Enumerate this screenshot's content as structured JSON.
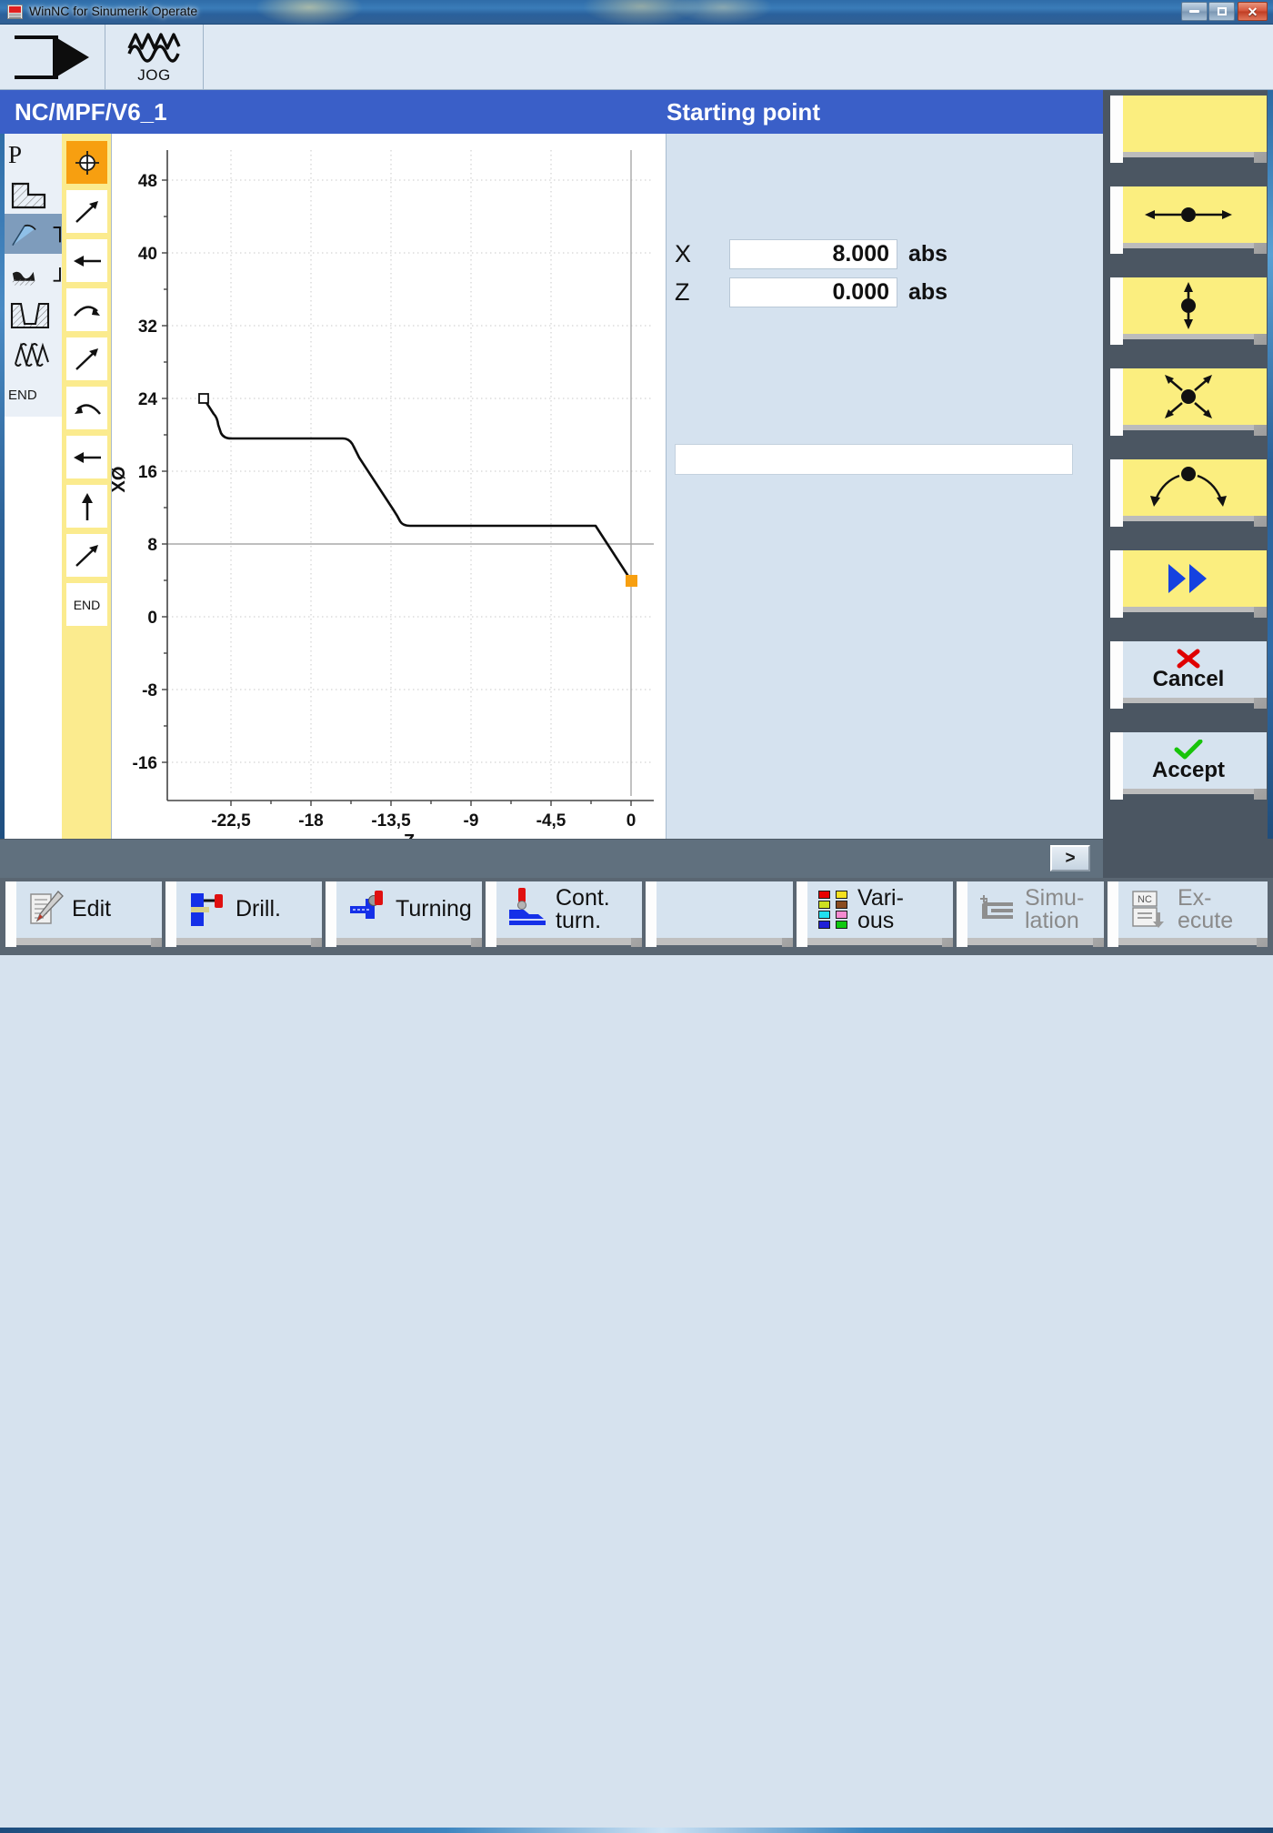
{
  "window": {
    "title": "WinNC for Sinumerik Operate",
    "minimize_label": "minimize",
    "maximize_label": "maximize",
    "close_label": "✕"
  },
  "mode_toolbar": {
    "machine_icon": "machine-area-icon",
    "jog": {
      "label": "JOG",
      "icon": "jog-wave-icon"
    }
  },
  "header": {
    "program_path": "NC/MPF/V6_1",
    "dialog_title": "Starting point"
  },
  "op_rail": {
    "items": [
      {
        "name": "program-label",
        "label": "P",
        "icon": "p-letter",
        "selected": false
      },
      {
        "name": "stock-removal",
        "label": "",
        "icon": "stock-removal-icon",
        "selected": false
      },
      {
        "name": "contour-turning",
        "label": "",
        "icon": "contour-turn-icon",
        "selected": true
      },
      {
        "name": "groove-relief",
        "label": "",
        "icon": "groove-icon",
        "selected": false
      },
      {
        "name": "recess",
        "label": "",
        "icon": "recess-icon",
        "selected": false
      },
      {
        "name": "thread",
        "label": "",
        "icon": "thread-icon",
        "selected": false
      },
      {
        "name": "end-marker",
        "label": "END",
        "icon": "end-label",
        "selected": false
      }
    ]
  },
  "contour_elements": {
    "items": [
      {
        "name": "start-point",
        "icon": "crosshair-icon",
        "label": "",
        "active": true
      },
      {
        "name": "line-diagonal-1",
        "icon": "arrow-up-right-icon",
        "label": "",
        "active": false
      },
      {
        "name": "line-horizontal-1",
        "icon": "arrow-left-icon",
        "label": "",
        "active": false
      },
      {
        "name": "arc-cw-1",
        "icon": "arc-clockwise-icon",
        "label": "",
        "active": false
      },
      {
        "name": "line-diagonal-2",
        "icon": "arrow-up-right-icon",
        "label": "",
        "active": false
      },
      {
        "name": "arc-ccw-1",
        "icon": "arc-counterclockwise-icon",
        "label": "",
        "active": false
      },
      {
        "name": "line-horizontal-2",
        "icon": "arrow-left-icon",
        "label": "",
        "active": false
      },
      {
        "name": "line-vertical-1",
        "icon": "arrow-up-icon",
        "label": "",
        "active": false
      },
      {
        "name": "line-diagonal-3",
        "icon": "arrow-up-right-icon",
        "label": "",
        "active": false
      },
      {
        "name": "contour-end",
        "icon": "",
        "label": "END",
        "active": false
      }
    ]
  },
  "form": {
    "fields": [
      {
        "axis": "X",
        "value": "8.000",
        "unit": "abs"
      },
      {
        "axis": "Z",
        "value": "0.000",
        "unit": "abs"
      }
    ],
    "comment_value": "",
    "comment_placeholder": ""
  },
  "softkeys_vertical": [
    {
      "name": "softkey-blank",
      "icon": "",
      "label": "",
      "style": "yellow"
    },
    {
      "name": "softkey-transition-horizontal",
      "icon": "dot-horizontal-arrows-icon",
      "label": "",
      "style": "yellow"
    },
    {
      "name": "softkey-transition-vertical",
      "icon": "dot-vertical-arrows-icon",
      "label": "",
      "style": "yellow"
    },
    {
      "name": "softkey-transition-diagonal",
      "icon": "dot-diagonal-arrows-icon",
      "label": "",
      "style": "yellow"
    },
    {
      "name": "softkey-transition-tangential",
      "icon": "dot-arc-arrows-icon",
      "label": "",
      "style": "yellow"
    },
    {
      "name": "softkey-all-parameters",
      "icon": "double-chevron-right-icon",
      "label": "",
      "style": "yellow"
    },
    {
      "name": "softkey-cancel",
      "icon": "red-cross-icon",
      "label": "Cancel",
      "style": "pale"
    },
    {
      "name": "softkey-accept",
      "icon": "green-check-icon",
      "label": "Accept",
      "style": "pale"
    }
  ],
  "status_bar": {
    "next_key_label": ">"
  },
  "softkeys_horizontal": [
    {
      "name": "hk-edit",
      "label": "Edit",
      "label2": "",
      "icon": "edit-pencil-icon",
      "disabled": false
    },
    {
      "name": "hk-drill",
      "label": "Drill.",
      "label2": "",
      "icon": "drilling-icon",
      "disabled": false
    },
    {
      "name": "hk-turning",
      "label": "Turning",
      "label2": "",
      "icon": "turning-icon",
      "disabled": false
    },
    {
      "name": "hk-contour-turning",
      "label": "Cont.",
      "label2": "turn.",
      "icon": "contour-turning-icon",
      "disabled": false
    },
    {
      "name": "hk-empty",
      "label": "",
      "label2": "",
      "icon": "",
      "disabled": false
    },
    {
      "name": "hk-various",
      "label": "Vari-",
      "label2": "ous",
      "icon": "various-colors-icon",
      "disabled": false
    },
    {
      "name": "hk-simulation",
      "label": "Simu-",
      "label2": "lation",
      "icon": "simulation-icon",
      "disabled": true
    },
    {
      "name": "hk-execute",
      "label": "Ex-",
      "label2": "ecute",
      "icon": "nc-execute-icon",
      "disabled": true
    }
  ],
  "chart_data": {
    "type": "line",
    "title": "",
    "xlabel": "Z",
    "ylabel": "XØ",
    "xlim": [
      -26.2,
      1.8
    ],
    "ylim": [
      -21.5,
      52.5
    ],
    "xticks": [
      -22.5,
      -18,
      -13.5,
      -9,
      -4.5,
      0
    ],
    "xtick_labels": [
      "-22,5",
      "-18",
      "-13,5",
      "-9",
      "-4,5",
      "0"
    ],
    "yticks": [
      -16,
      -8,
      0,
      8,
      16,
      24,
      32,
      40,
      48
    ],
    "ytick_labels": [
      "-16",
      "-8",
      "0",
      "8",
      "16",
      "24",
      "32",
      "40",
      "48"
    ],
    "grid": true,
    "zero_line_axis": "y",
    "series": [
      {
        "name": "contour",
        "color": "#111111",
        "points": [
          {
            "z": -24.0,
            "x": 24.0
          },
          {
            "z": -23.2,
            "x": 22.2
          },
          {
            "z": -22.6,
            "x": 20.0
          },
          {
            "z": -16.6,
            "x": 20.0
          },
          {
            "z": -16.0,
            "x": 18.1
          },
          {
            "z": -13.4,
            "x": 13.2
          },
          {
            "z": -12.8,
            "x": 12.0
          },
          {
            "z": -2.0,
            "x": 12.0
          },
          {
            "z": 0.0,
            "x": 8.0
          }
        ]
      }
    ],
    "markers": [
      {
        "name": "contour-origin-marker",
        "z": -24.0,
        "x": 24.0,
        "style": "square-outline",
        "color": "#ffffff"
      },
      {
        "name": "start-point-marker",
        "z": 0.0,
        "x": 8.0,
        "style": "square-filled",
        "color": "#f79f10"
      }
    ]
  }
}
